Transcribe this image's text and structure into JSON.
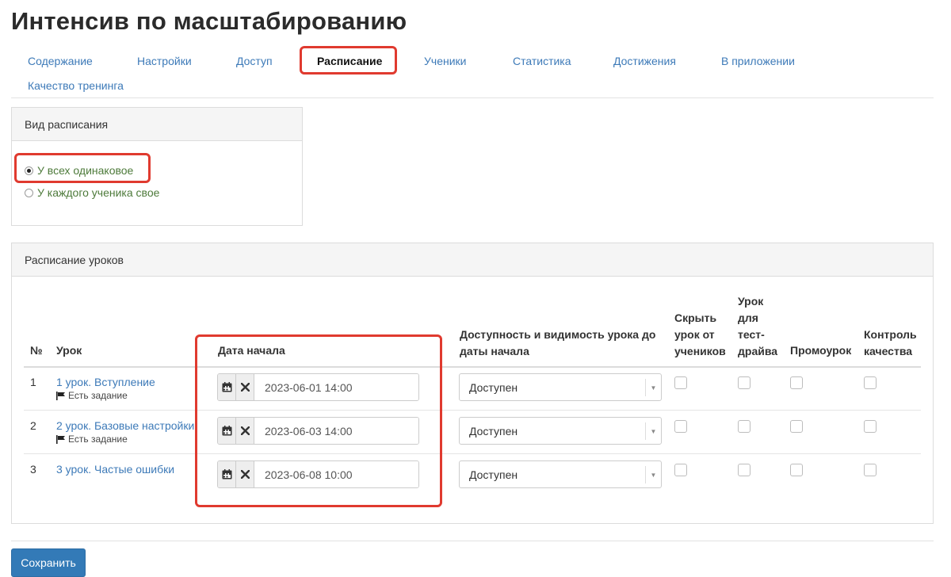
{
  "page": {
    "title": "Интенсив по масштабированию"
  },
  "tabs": [
    {
      "label": "Содержание"
    },
    {
      "label": "Настройки"
    },
    {
      "label": "Доступ"
    },
    {
      "label": "Расписание"
    },
    {
      "label": "Ученики"
    },
    {
      "label": "Статистика"
    },
    {
      "label": "Достижения"
    },
    {
      "label": "В приложении"
    },
    {
      "label": "Качество тренинга"
    }
  ],
  "active_tab": "Расписание",
  "schedule_type": {
    "title": "Вид расписания",
    "options": [
      {
        "label": "У всех одинаковое",
        "checked": true
      },
      {
        "label": "У каждого ученика свое",
        "checked": false
      }
    ]
  },
  "lessons_panel": {
    "title": "Расписание уроков",
    "headers": {
      "num": "№",
      "lesson": "Урок",
      "start_date": "Дата начала",
      "availability_line1": "Доступность и видимость урока до",
      "availability_line2": "даты начала",
      "hide_line1": "Скрыть",
      "hide_line2": "урок от",
      "hide_line3": "учеников",
      "testdrive_line1": "Урок",
      "testdrive_line2": "для",
      "testdrive_line3": "тест-",
      "testdrive_line4": "драйва",
      "promo": "Промоурок",
      "quality_line1": "Контроль",
      "quality_line2": "качества"
    },
    "rows": [
      {
        "num": "1",
        "title": "1 урок. Вступление",
        "badge": "Есть задание",
        "start": "2023-06-01 14:00",
        "availability": "Доступен",
        "hide": false,
        "testdrive": false,
        "promo": false,
        "quality": false
      },
      {
        "num": "2",
        "title": "2 урок. Базовые настройки",
        "badge": "Есть задание",
        "start": "2023-06-03 14:00",
        "availability": "Доступен",
        "hide": false,
        "testdrive": false,
        "promo": false,
        "quality": false
      },
      {
        "num": "3",
        "title": "3 урок. Частые ошибки",
        "badge": "",
        "start": "2023-06-08 10:00",
        "availability": "Доступен",
        "hide": false,
        "testdrive": false,
        "promo": false,
        "quality": false
      }
    ]
  },
  "actions": {
    "save_label": "Сохранить"
  },
  "colors": {
    "link": "#3d7ab8",
    "highlight": "#e03a2f",
    "primary_button": "#337ab7",
    "radio_label": "#4d7a3a"
  },
  "icons": {
    "calendar": "calendar-icon",
    "clear": "close-icon",
    "flag": "flag-icon",
    "dropdown": "caret-down-icon"
  }
}
